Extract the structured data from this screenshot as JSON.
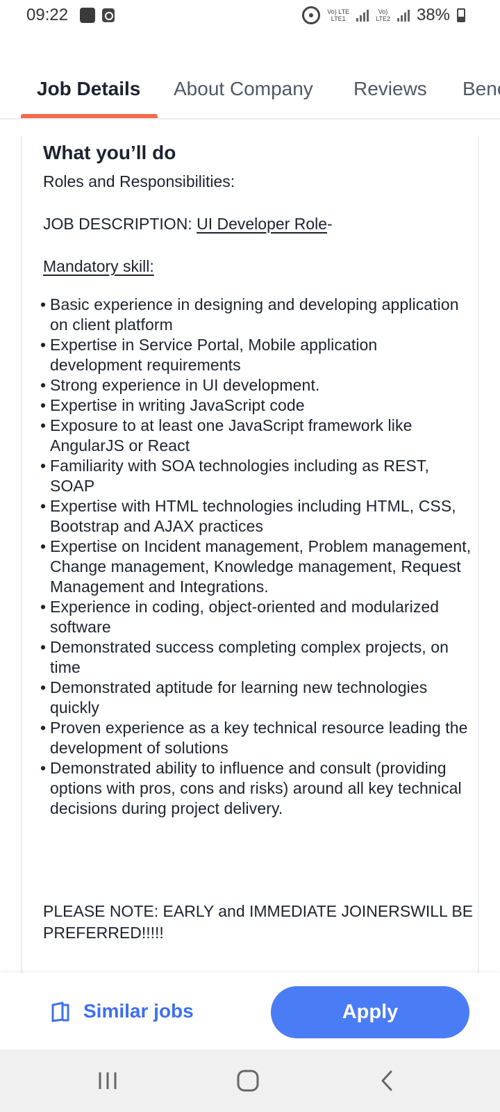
{
  "status_bar": {
    "time": "09:22",
    "net1": "Vo) LTE\nLTE1",
    "net2": "Vo)\nLTE2",
    "battery": "38%"
  },
  "tabs": [
    {
      "label": "Job Details",
      "active": true
    },
    {
      "label": "About Company",
      "active": false
    },
    {
      "label": "Reviews",
      "active": false
    },
    {
      "label": "Benefits",
      "active": false
    }
  ],
  "job": {
    "section_title": "What you’ll do",
    "roles_heading": "Roles and Responsibilities:",
    "desc_prefix": "JOB DESCRIPTION: ",
    "desc_role": "UI Developer Role",
    "desc_suffix": "-",
    "mandatory_label": "Mandatory skill:",
    "bullets": [
      "Basic experience in designing and developing application on client platform",
      "Expertise in Service Portal, Mobile application development requirements",
      "Strong experience in UI development.",
      "Expertise in writing JavaScript code",
      "Exposure to at least one JavaScript framework like AngularJS or React",
      "Familiarity with SOA technologies including as REST, SOAP",
      "Expertise with HTML technologies including HTML, CSS, Bootstrap and AJAX practices",
      "Expertise on Incident management, Problem management, Change management, Knowledge management, Request Management and Integrations.",
      "Experience in coding, object-oriented and modularized software",
      "Demonstrated success completing complex projects, on time",
      "Demonstrated aptitude for learning new technologies quickly",
      "Proven experience as a key technical resource leading the development of solutions",
      "Demonstrated ability to influence and consult (providing options with pros, cons and risks) around all key technical decisions during project delivery."
    ],
    "note": "PLEASE NOTE: EARLY and IMMEDIATE JOINERSWILL BE PREFERRED!!!!!"
  },
  "actions": {
    "similar_jobs": "Similar jobs",
    "apply": "Apply"
  },
  "colors": {
    "accent": "#4a7cf5",
    "tab_underline": "#f26b4f"
  },
  "icons": {
    "similar": "copy-icon",
    "nav_recents": "recents-icon",
    "nav_home": "home-icon",
    "nav_back": "back-icon"
  }
}
